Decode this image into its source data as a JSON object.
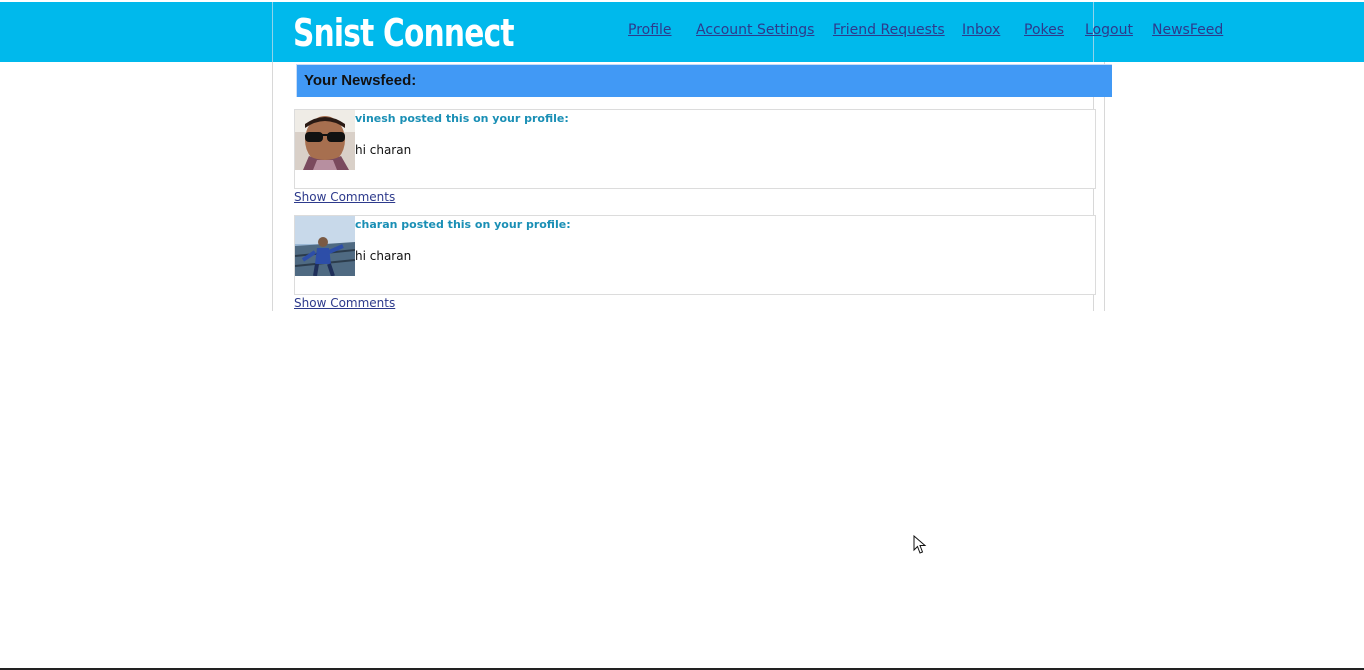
{
  "header": {
    "logo": "Snist Connect",
    "nav": [
      "Profile",
      "Account Settings",
      "Friend Requests",
      "Inbox",
      "Pokes",
      "Logout",
      "NewsFeed"
    ]
  },
  "feed": {
    "title": "Your Newsfeed:",
    "posts": [
      {
        "author_line": "vinesh posted this on your profile:",
        "body": "hi charan",
        "comments_link": "Show Comments"
      },
      {
        "author_line": "charan posted this on your profile:",
        "body": "hi charan",
        "comments_link": "Show Comments"
      }
    ]
  },
  "colors": {
    "topbar": "#00b9ec",
    "feed_header": "#4199f5",
    "author_text": "#1a8fb5",
    "link": "#2d3a8c"
  },
  "icons": [
    "pointer-cursor-icon"
  ]
}
